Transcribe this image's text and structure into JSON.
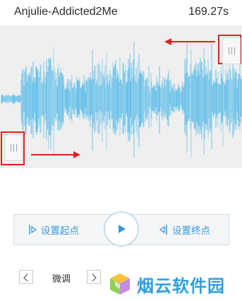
{
  "header": {
    "title": "Anjulie-Addicted2Me",
    "duration": "169.27s"
  },
  "waveform": {
    "color": "#3ab2e8",
    "background": "#efefef",
    "annotation_color": "#e02020"
  },
  "controls": {
    "set_start_label": "设置起点",
    "set_end_label": "设置终点",
    "accent_color": "#3c98d6"
  },
  "fine_tune": {
    "label": "微调"
  },
  "watermark": {
    "text": "烟云软件园"
  }
}
